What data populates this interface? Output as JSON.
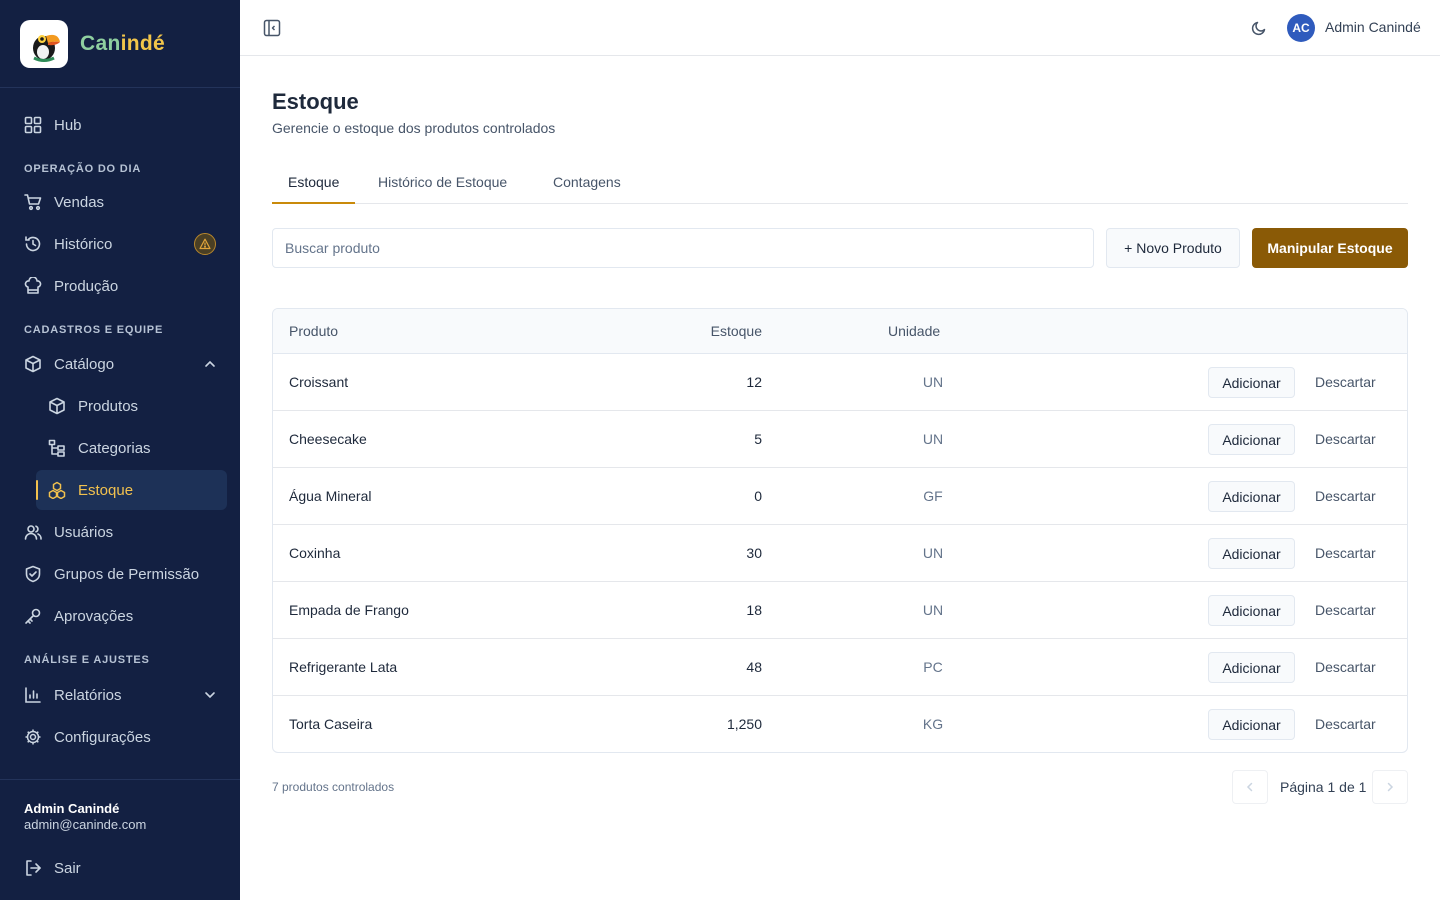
{
  "brand": {
    "name_part1": "Can",
    "name_part2": "indé"
  },
  "sidebar": {
    "hub": "Hub",
    "sections": [
      "OPERAÇÃO DO DIA",
      "CADASTROS E EQUIPE",
      "ANÁLISE E AJUSTES"
    ],
    "items": {
      "vendas": "Vendas",
      "historico": "Histórico",
      "producao": "Produção",
      "catalogo": "Catálogo",
      "produtos": "Produtos",
      "categorias": "Categorias",
      "estoque": "Estoque",
      "usuarios": "Usuários",
      "grupos": "Grupos de Permissão",
      "aprovacoes": "Aprovações",
      "relatorios": "Relatórios",
      "configuracoes": "Configurações"
    },
    "user": {
      "name": "Admin Canindé",
      "email": "admin@caninde.com"
    },
    "logout": "Sair"
  },
  "topbar": {
    "avatar_initials": "AC",
    "user_name": "Admin Canindé"
  },
  "page": {
    "title": "Estoque",
    "subtitle": "Gerencie o estoque dos produtos controlados"
  },
  "tabs": [
    "Estoque",
    "Histórico de Estoque",
    "Contagens"
  ],
  "search": {
    "placeholder": "Buscar produto",
    "value": ""
  },
  "buttons": {
    "new_product": "+ Novo Produto",
    "manipulate": "Manipular Estoque"
  },
  "table": {
    "headers": {
      "product": "Produto",
      "stock": "Estoque",
      "unit": "Unidade"
    },
    "rows": [
      {
        "product": "Croissant",
        "stock": "12",
        "unit": "UN",
        "add": "Adicionar",
        "discard": "Descartar"
      },
      {
        "product": "Cheesecake",
        "stock": "5",
        "unit": "UN",
        "add": "Adicionar",
        "discard": "Descartar"
      },
      {
        "product": "Água Mineral",
        "stock": "0",
        "unit": "GF",
        "add": "Adicionar",
        "discard": "Descartar"
      },
      {
        "product": "Coxinha",
        "stock": "30",
        "unit": "UN",
        "add": "Adicionar",
        "discard": "Descartar"
      },
      {
        "product": "Empada de Frango",
        "stock": "18",
        "unit": "UN",
        "add": "Adicionar",
        "discard": "Descartar"
      },
      {
        "product": "Refrigerante Lata",
        "stock": "48",
        "unit": "PC",
        "add": "Adicionar",
        "discard": "Descartar"
      },
      {
        "product": "Torta Caseira",
        "stock": "1,250",
        "unit": "KG",
        "add": "Adicionar",
        "discard": "Descartar"
      }
    ]
  },
  "footer": {
    "count": "7 produtos controlados",
    "page_label": "Página 1 de 1"
  },
  "colors": {
    "sidebar_bg": "#132042",
    "accent": "#c98a0a",
    "primary_button": "#8a5a06",
    "active_text": "#f2c14e"
  }
}
